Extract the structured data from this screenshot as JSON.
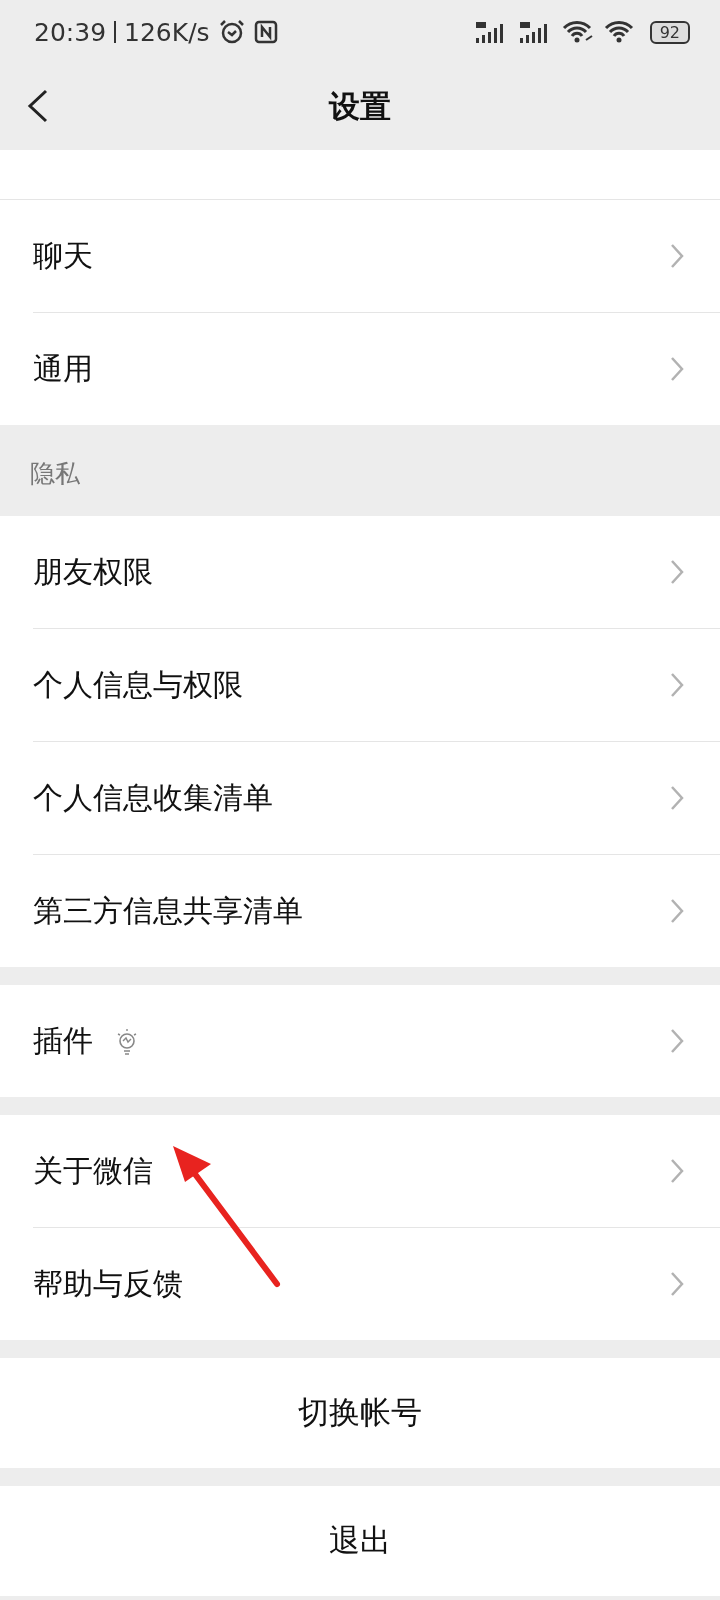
{
  "status_bar": {
    "time": "20:39",
    "speed": "126K/s",
    "battery": "92"
  },
  "header": {
    "title": "设置"
  },
  "groups": [
    {
      "items": [
        {
          "label": "聊天",
          "kind": "plain"
        },
        {
          "label": "通用",
          "kind": "plain"
        }
      ]
    },
    {
      "label": "隐私",
      "items": [
        {
          "label": "朋友权限",
          "kind": "plain"
        },
        {
          "label": "个人信息与权限",
          "kind": "plain"
        },
        {
          "label": "个人信息收集清单",
          "kind": "plain"
        },
        {
          "label": "第三方信息共享清单",
          "kind": "plain"
        }
      ]
    },
    {
      "items": [
        {
          "label": "插件",
          "kind": "bulb"
        }
      ]
    },
    {
      "items": [
        {
          "label": "关于微信",
          "kind": "plain"
        },
        {
          "label": "帮助与反馈",
          "kind": "plain"
        }
      ]
    }
  ],
  "actions": [
    {
      "label": "切换帐号"
    },
    {
      "label": "退出"
    }
  ]
}
